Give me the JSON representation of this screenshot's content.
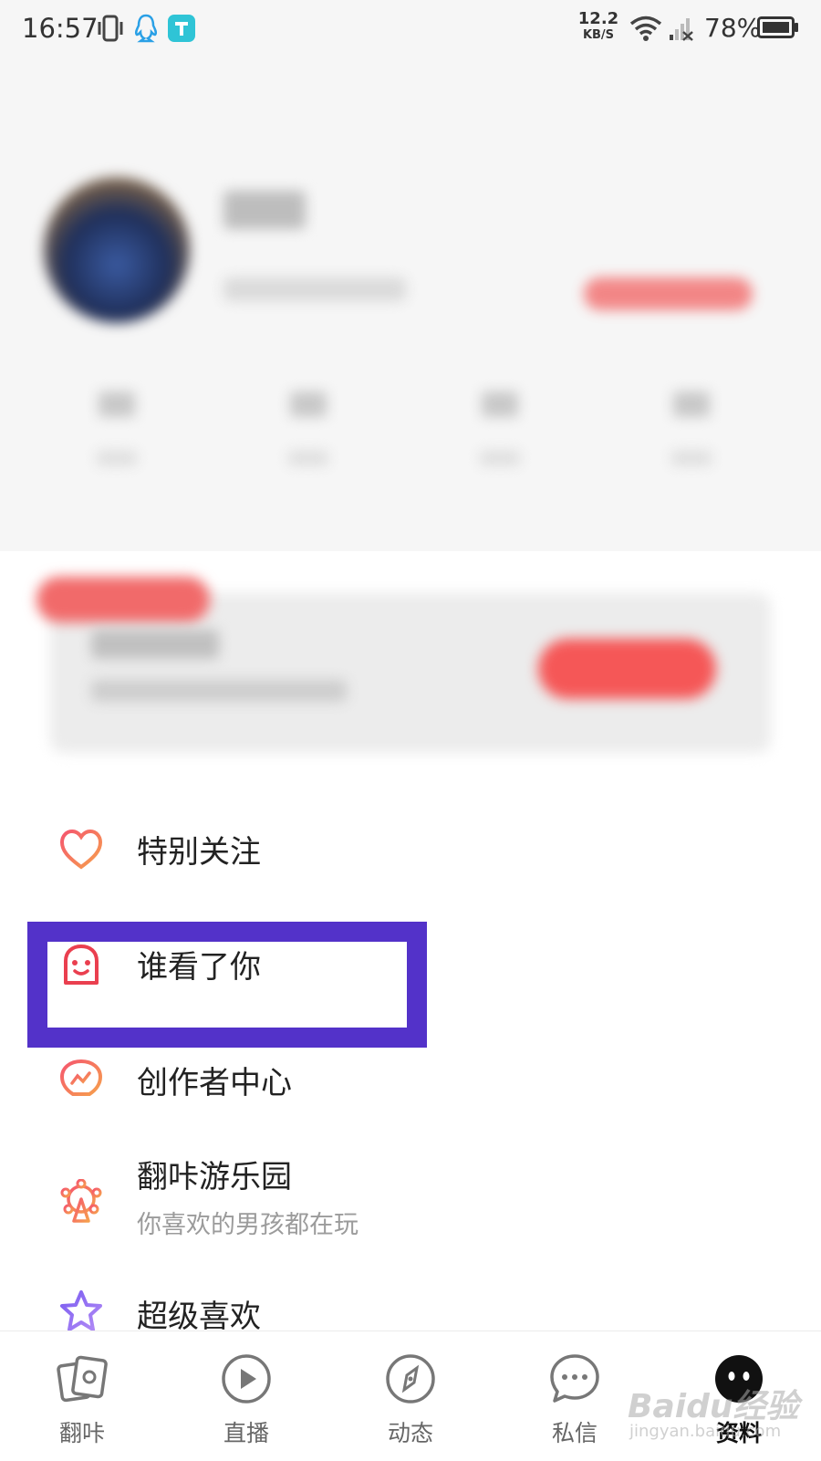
{
  "status_bar": {
    "time": "16:57",
    "net_speed_value": "12.2",
    "net_speed_unit": "KB/S",
    "battery": "78%",
    "icons": [
      "vibrate-icon",
      "qq-icon",
      "app-icon",
      "wifi-icon",
      "signal-icon",
      "battery-icon"
    ]
  },
  "menu": {
    "items": [
      {
        "label": "特别关注",
        "icon": "heart-icon"
      },
      {
        "label": "谁看了你",
        "icon": "ghost-face-icon"
      },
      {
        "label": "创作者中心",
        "icon": "creator-bulb-icon"
      },
      {
        "label": "翻咔游乐园",
        "sub": "你喜欢的男孩都在玩",
        "icon": "ferris-wheel-icon"
      },
      {
        "label": "超级喜欢",
        "icon": "star-icon"
      }
    ],
    "highlight_color": "#5332c9"
  },
  "bottom_nav": {
    "tabs": [
      {
        "label": "翻咔",
        "icon": "cards-icon"
      },
      {
        "label": "直播",
        "icon": "play-icon"
      },
      {
        "label": "动态",
        "icon": "compass-icon"
      },
      {
        "label": "私信",
        "icon": "chat-bubble-icon"
      },
      {
        "label": "资料",
        "icon": "profile-face-icon",
        "active": true
      }
    ]
  },
  "watermark": {
    "brand": "Baidu经验",
    "url": "jingyan.baidu.com"
  },
  "colors": {
    "accent": "#f55757",
    "icon_gradient_start": "#f5566e",
    "icon_gradient_end": "#f6a04d"
  }
}
